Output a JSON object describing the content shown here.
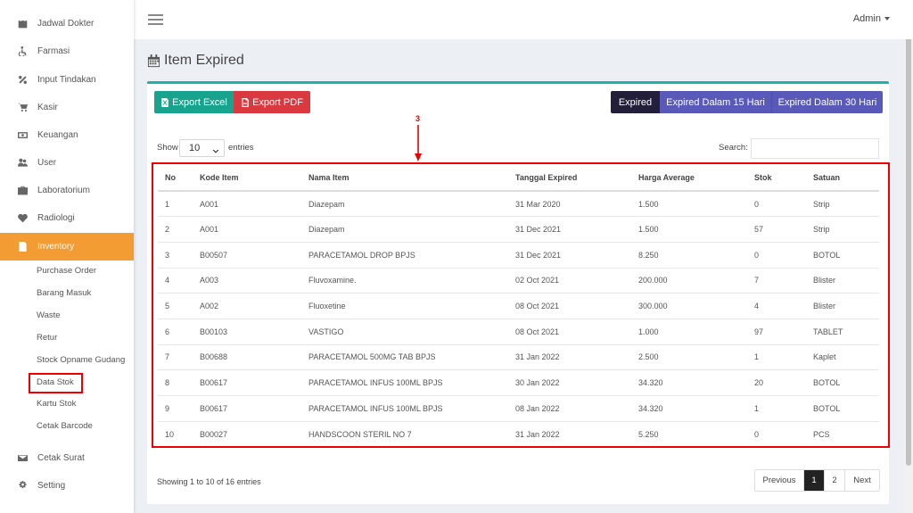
{
  "sidebar": {
    "items": [
      {
        "label": "Jadwal Dokter",
        "icon": "calendar-icon"
      },
      {
        "label": "Farmasi",
        "icon": "wheelchair-icon"
      },
      {
        "label": "Input Tindakan",
        "icon": "percent-icon"
      },
      {
        "label": "Kasir",
        "icon": "cart-icon"
      },
      {
        "label": "Keuangan",
        "icon": "money-icon"
      },
      {
        "label": "User",
        "icon": "users-icon"
      },
      {
        "label": "Laboratorium",
        "icon": "briefcase-icon"
      },
      {
        "label": "Radiologi",
        "icon": "heartbeat-icon"
      },
      {
        "label": "Inventory",
        "icon": "document-icon"
      }
    ],
    "submenu": [
      "Purchase Order",
      "Barang Masuk",
      "Waste",
      "Retur",
      "Stock Opname Gudang",
      "Data Stok",
      "Kartu Stok",
      "Cetak Barcode"
    ],
    "bottom_items": [
      {
        "label": "Cetak Surat",
        "icon": "envelope-icon"
      },
      {
        "label": "Setting",
        "icon": "gear-icon"
      }
    ]
  },
  "topbar": {
    "user": "Admin"
  },
  "page": {
    "title": "Item Expired"
  },
  "toolbar": {
    "export_excel": "Export Excel",
    "export_pdf": "Export PDF",
    "filter_expired": "Expired",
    "filter_15": "Expired Dalam 15 Hari",
    "filter_30": "Expired Dalam 30 Hari"
  },
  "table_controls": {
    "show_label": "Show",
    "page_length": "10",
    "entries_label": "entries",
    "search_label": "Search:"
  },
  "annotation": {
    "number": "3"
  },
  "table": {
    "headers": [
      "No",
      "Kode Item",
      "Nama Item",
      "Tanggal Expired",
      "Harga Average",
      "Stok",
      "Satuan"
    ],
    "rows": [
      [
        "1",
        "A001",
        "Diazepam",
        "31 Mar 2020",
        "1.500",
        "0",
        "Strip"
      ],
      [
        "2",
        "A001",
        "Diazepam",
        "31 Dec 2021",
        "1.500",
        "57",
        "Strip"
      ],
      [
        "3",
        "B00507",
        "PARACETAMOL DROP BPJS",
        "31 Dec 2021",
        "8.250",
        "0",
        "BOTOL"
      ],
      [
        "4",
        "A003",
        "Fluvoxamine.",
        "02 Oct 2021",
        "200.000",
        "7",
        "Blister"
      ],
      [
        "5",
        "A002",
        "Fluoxetine",
        "08 Oct 2021",
        "300.000",
        "4",
        "Blister"
      ],
      [
        "6",
        "B00103",
        "VASTIGO",
        "08 Oct 2021",
        "1.000",
        "97",
        "TABLET"
      ],
      [
        "7",
        "B00688",
        "PARACETAMOL 500MG TAB BPJS",
        "31 Jan 2022",
        "2.500",
        "1",
        "Kaplet"
      ],
      [
        "8",
        "B00617",
        "PARACETAMOL INFUS 100ML BPJS",
        "30 Jan 2022",
        "34.320",
        "20",
        "BOTOL"
      ],
      [
        "9",
        "B00617",
        "PARACETAMOL INFUS 100ML BPJS",
        "08 Jan 2022",
        "34.320",
        "1",
        "BOTOL"
      ],
      [
        "10",
        "B00027",
        "HANDSCOON STERIL NO 7",
        "31 Jan 2022",
        "5.250",
        "0",
        "PCS"
      ]
    ]
  },
  "footer": {
    "info": "Showing 1 to 10 of 16 entries",
    "prev": "Previous",
    "page1": "1",
    "page2": "2",
    "next": "Next"
  },
  "colors": {
    "inventory_active": "#f39c34",
    "export_excel": "#17a38e",
    "export_pdf": "#d9393f",
    "expired_btn": "#231e3a",
    "expired_range_btn": "#5859b9",
    "box_top": "#20b2aa",
    "annotation": "#e00000"
  }
}
